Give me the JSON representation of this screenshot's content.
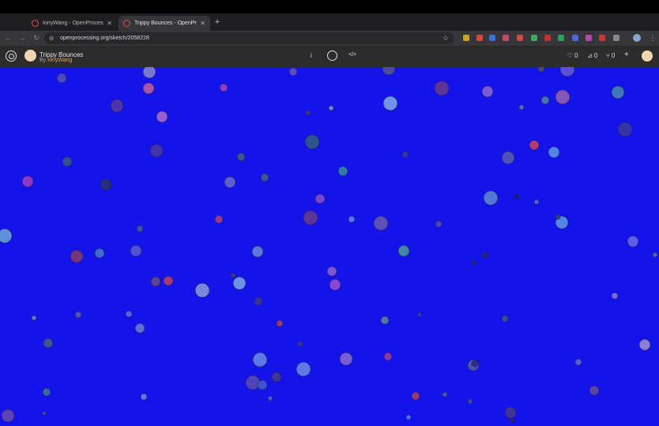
{
  "browser": {
    "tabs": [
      {
        "title": "IonyWang - OpenProcessing",
        "active": false
      },
      {
        "title": "Trippy Bounces - OpenProce",
        "active": true
      }
    ],
    "new_tab": "+",
    "url": "openprocessing.org/sketch/2058228"
  },
  "sketch": {
    "title": "Trippy Bounces",
    "by_prefix": "By",
    "author": "IonyWang",
    "info_icon": "i",
    "code_label": "</>",
    "likes": "0",
    "collections": "0",
    "forks": "0",
    "add_label": "+",
    "background_color": "#1414ea"
  }
}
